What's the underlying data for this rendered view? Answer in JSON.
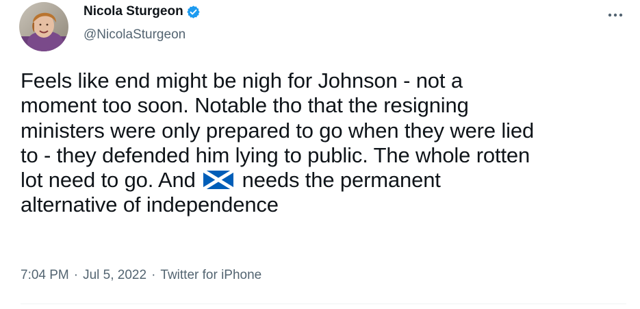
{
  "author": {
    "display_name": "Nicola Sturgeon",
    "handle": "@NicolaSturgeon",
    "verified": true,
    "avatar_icon": "profile-photo",
    "verified_icon": "verified-badge-icon"
  },
  "menu": {
    "icon": "more-options-icon"
  },
  "tweet": {
    "lines": {
      "l1": "Feels like end might be nigh for Johnson - not a",
      "l2": "moment too soon. Notable tho that the resigning",
      "l3": "ministers were only prepared to go when they were lied",
      "l4": "to - they defended him lying to public. The whole rotten",
      "l5_before_flag": "lot need to go. And",
      "l5_after_flag": "needs the permanent",
      "l6": "alternative of independence"
    },
    "emoji": "scotland-flag-icon"
  },
  "meta": {
    "time": "7:04 PM",
    "separator": "·",
    "date": "Jul 5, 2022",
    "source": "Twitter for iPhone"
  },
  "colors": {
    "text": "#0f1419",
    "secondary": "#536471",
    "verified": "#1d9bf0",
    "flag_blue": "#005eb8",
    "divider": "#eff3f4"
  }
}
